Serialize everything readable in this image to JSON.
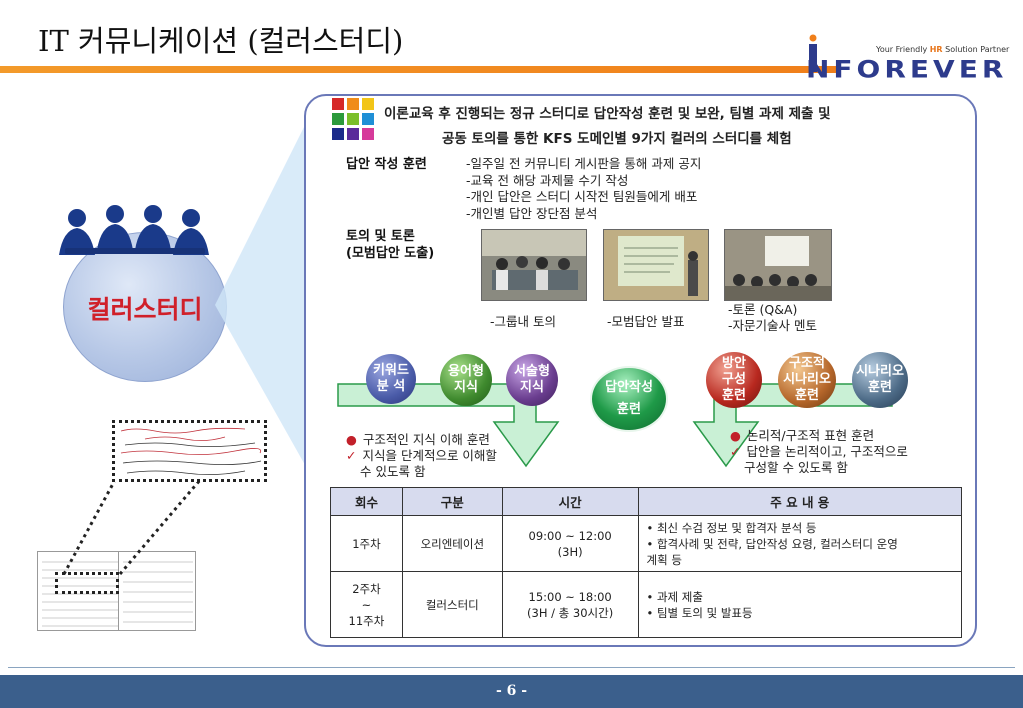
{
  "title": "IT 커뮤니케이션 (컬러스터디)",
  "logo": {
    "tagline_pre": "Your Friendly ",
    "tagline_hr": "HR",
    "tagline_post": " Solution Partner",
    "word": "NFOREVER"
  },
  "circle_label": "컬러스터디",
  "headline": {
    "line1": "이론교육 후 진행되는 정규 스터디로  답안작성 훈련 및 보완,  팀별 과제 제출 및",
    "line2": "공동 토의를 통한  KFS 도메인별 9가지 컬러의 스터디를 체험"
  },
  "answer_training": {
    "label": "답안 작성 훈련",
    "items": [
      "-일주일 전 커뮤니티 게시판을 통해 과제 공지",
      "-교육 전 해당 과제물 수기 작성",
      "-개인 답안은 스터디 시작전 팀원들에게 배포",
      "-개인별 답안 장단점 분석"
    ]
  },
  "discussion": {
    "label1": "토의 및 토론",
    "label2": "(모범답안 도출)",
    "captions": [
      "-그룹내 토의",
      "-모범답안 발표",
      "-토론 (Q&A)",
      "-자문기술사 멘토"
    ]
  },
  "flow": {
    "left_balls": [
      {
        "l1": "키워드",
        "l2": "분   석",
        "color": "#4a5ba8"
      },
      {
        "l1": "용어형",
        "l2": "지식",
        "color": "#3f8a2e"
      },
      {
        "l1": "서술형",
        "l2": "지식",
        "color": "#6a3d8f"
      }
    ],
    "center": {
      "l1": "답안작성",
      "l2": "훈련",
      "color": "#1f9a48"
    },
    "right_balls": [
      {
        "l1": "방안",
        "l2": "구성",
        "l3": "훈련",
        "color": "#b8281f"
      },
      {
        "l1": "구조적",
        "l2": "시나리오",
        "l3": "훈련",
        "color": "#b5662a"
      },
      {
        "l1": "시나리오",
        "l2": "훈련",
        "color": "#4c6a86"
      }
    ]
  },
  "notes_left": {
    "bullet": "구조적인 지식 이해 훈련",
    "check_l1": "지식을 단계적으로 이해할",
    "check_l2": "수 있도록 함"
  },
  "notes_right": {
    "bullet": "논리적/구조적 표현 훈련",
    "check_l1": "답안을 논리적이고, 구조적으로",
    "check_l2": "구성할 수 있도록 함"
  },
  "table": {
    "headers": [
      "회수",
      "구분",
      "시간",
      "주 요 내 용"
    ],
    "row1": {
      "round": "1주차",
      "type": "오리엔테이션",
      "time1": "09:00 ~ 12:00",
      "time2": "(3H)",
      "c1": "• 최신 수검 정보 및 합격자 분석 등",
      "c2": "• 합격사례 및 전략, 답안작성 요령, 컬러스터디 운영",
      "c3": "   계획 등"
    },
    "row2": {
      "round1": "2주차",
      "round2": "~",
      "round3": "11주차",
      "type": "컬러스터디",
      "time1": "15:00 ~ 18:00",
      "time2": "(3H / 총 30시간)",
      "c1": "• 과제 제출",
      "c2": "• 팀별 토의 및 발표등"
    }
  },
  "page_number": "- 6 -",
  "colors": {
    "accent_orange": "#f39a2a",
    "footer_blue": "#3b5f8c",
    "panel_border": "#6a78b8",
    "label_red": "#d0202a"
  }
}
